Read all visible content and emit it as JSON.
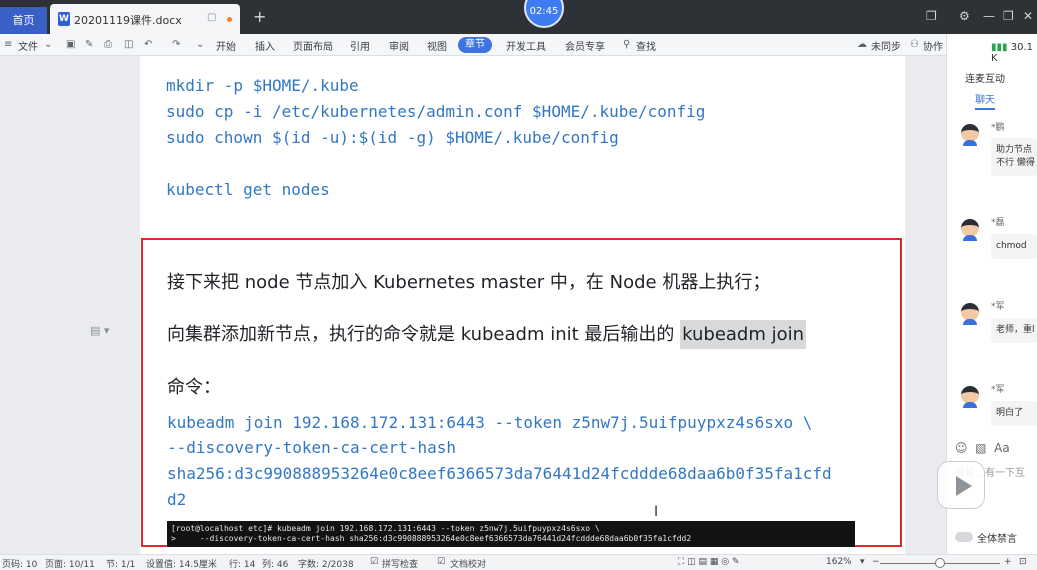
{
  "titlebar": {
    "home_tab": "首页",
    "doc_tab": "20201119课件.docx",
    "doc_icon": "W",
    "new_tab": "+",
    "timer": "02:45"
  },
  "ribbon": {
    "file_menu": "文件",
    "tabs": [
      "开始",
      "插入",
      "页面布局",
      "引用",
      "审阅",
      "视图",
      "章节",
      "开发工具",
      "会员专享"
    ],
    "active_tab": "章节",
    "search": "查找",
    "unsync": "未同步",
    "collab": "协作"
  },
  "document": {
    "code_lines": [
      "mkdir -p $HOME/.kube",
      "sudo cp -i /etc/kubernetes/admin.conf $HOME/.kube/config",
      "sudo chown $(id -u):$(id -g) $HOME/.kube/config",
      "kubectl get nodes"
    ],
    "para1": "接下来把 node 节点加入 Kubernetes master 中，在 Node 机器上执行；",
    "para2_prefix": "向集群添加新节点，执行的命令就是 kubeadm init 最后输出的 ",
    "para2_highlight": "kubeadm join",
    "para3": "命令：",
    "join_lines": [
      "kubeadm join 192.168.172.131:6443 --token z5nw7j.5uifpuypxz4s6sxo \\",
      "--discovery-token-ca-cert-hash",
      "sha256:d3c990888953264e0c8eef6366573da76441d24fcddde68daa6b0f35fa1cfd",
      "d2"
    ],
    "terminal_lines": [
      "[root@localhost etc]# kubeadm join 192.168.172.131:6443 --token z5nw7j.5uifpuypxz4s6sxo \\",
      ">     --discovery-token-ca-cert-hash sha256:d3c990888953264e0c8eef6366573da76441d24fcddde68daa6b0f35fa1cfdd2"
    ]
  },
  "right_panel": {
    "signal": "30.1 K",
    "title": "连麦互动",
    "chat_tab": "聊天",
    "messages": [
      {
        "name": "*鹏",
        "text": "助力节点\n不行 懒得"
      },
      {
        "name": "*磊",
        "text": "chmod"
      },
      {
        "name": "*军",
        "text": "老师，重l"
      },
      {
        "name": "*军",
        "text": "明白了"
      }
    ],
    "input_hint": "评论…有一下互",
    "mute_all": "全体禁言"
  },
  "statusbar": {
    "page": "页码: 10",
    "pages": "页面: 10/11",
    "section": "节: 1/1",
    "setting": "设置值: 14.5厘米",
    "row": "行: 14",
    "col": "列: 46",
    "words": "字数: 2/2038",
    "spellcheck": "拼写检查",
    "proofread": "文档校对",
    "zoom": "162%",
    "zoom_level": 0.5
  },
  "colors": {
    "code": "#3277c4",
    "highlight_box": "#e0262e",
    "active_tab": "#3f74e0"
  }
}
